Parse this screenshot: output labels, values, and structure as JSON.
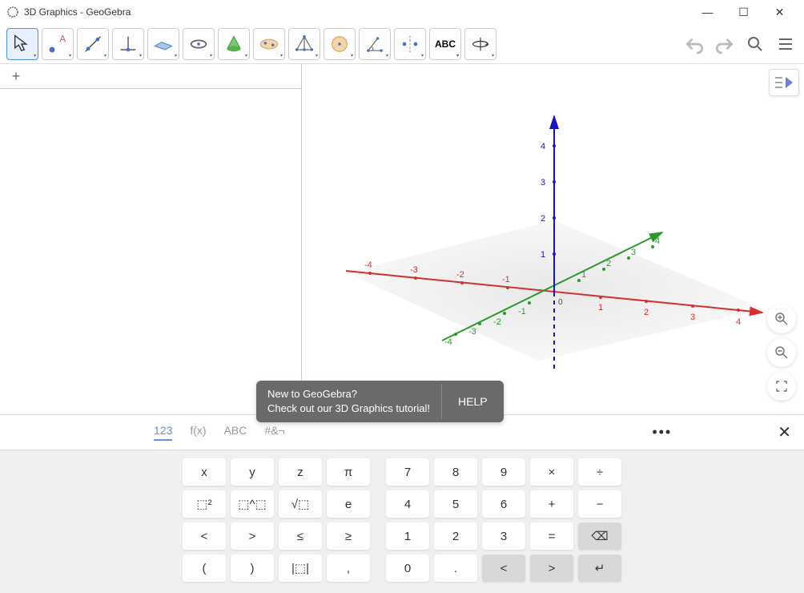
{
  "titlebar": {
    "title": "3D Graphics - GeoGebra"
  },
  "tools": [
    {
      "name": "move-tool"
    },
    {
      "name": "point-tool"
    },
    {
      "name": "line-tool"
    },
    {
      "name": "perp-tool"
    },
    {
      "name": "plane-tool"
    },
    {
      "name": "circle-tool"
    },
    {
      "name": "cone-tool"
    },
    {
      "name": "sphere-tool"
    },
    {
      "name": "pyramid-tool"
    },
    {
      "name": "ellipsoid-tool"
    },
    {
      "name": "angle-tool"
    },
    {
      "name": "reflect-tool"
    },
    {
      "name": "text-tool",
      "label": "ABC"
    },
    {
      "name": "rotate-view-tool"
    }
  ],
  "tutorial": {
    "line1": "New to GeoGebra?",
    "line2": "Check out our 3D Graphics tutorial!",
    "help": "HELP"
  },
  "inputtabs": {
    "t1": "123",
    "t2": "f(x)",
    "t3": "ABC",
    "t4": "#&¬"
  },
  "keyboard": {
    "r1": [
      "x",
      "y",
      "z",
      "π",
      "7",
      "8",
      "9",
      "×",
      "÷"
    ],
    "r2": [
      "⬚²",
      "⬚^⬚",
      "√⬚",
      "e",
      "4",
      "5",
      "6",
      "+",
      "−"
    ],
    "r3": [
      "<",
      ">",
      "≤",
      "≥",
      "1",
      "2",
      "3",
      "=",
      "⌫"
    ],
    "r4": [
      "(",
      ")",
      "|⬚|",
      ",",
      "0",
      ".",
      "<",
      ">",
      "↵"
    ]
  },
  "axes": {
    "x_ticks": [
      "-4",
      "-3",
      "-2",
      "-1",
      "1",
      "2",
      "3",
      "4"
    ],
    "y_ticks": [
      "-4",
      "-3",
      "-2",
      "-1",
      "1",
      "2",
      "3",
      "4"
    ],
    "z_ticks": [
      "1",
      "2",
      "3",
      "4"
    ]
  }
}
